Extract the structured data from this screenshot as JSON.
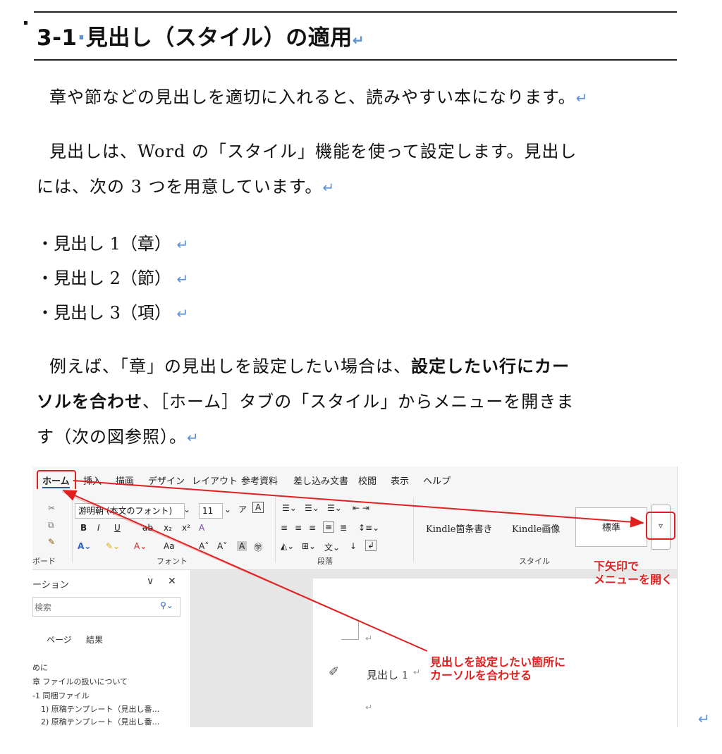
{
  "heading": {
    "number": "3-1",
    "dot": "·",
    "title": "見出し（スタイル）の適用",
    "return_mark": "↵"
  },
  "paragraphs": {
    "p1": "章や節などの見出しを適切に入れると、読みやすい本になります。",
    "p2a": "見出しは、Word の「スタイル」機能を使って設定します。見出し",
    "p2b": "には、次の 3 つを用意しています。",
    "p3_pre": "例えば、「章」の見出しを設定したい場合は、",
    "p3_bold1": "設定したい行にカー",
    "p3_bold2": "ソルを合わせ",
    "p3_mid": "、［ホーム］タブの「スタイル」からメニューを開きま",
    "p3_end": "す（次の図参照）。"
  },
  "list": [
    "・見出し 1（章）",
    "・見出し 2（節）",
    "・見出し 3（項）"
  ],
  "return_mark": "↵",
  "screenshot": {
    "tabs": [
      "ホーム",
      "挿入",
      "描画",
      "デザイン",
      "レイアウト",
      "参考資料",
      "差し込み文書",
      "校閲",
      "表示",
      "ヘルプ"
    ],
    "font_name": "游明朝 (本文のフォント)",
    "font_size": "11",
    "font_group": "フォント",
    "paragraph_group": "段落",
    "style_group": "スタイル",
    "clipboard_group": "ボード",
    "styles": [
      "Kindle箇条書き",
      "Kindle画像",
      "標準"
    ],
    "nav_title": "ーション",
    "nav_search": "検索",
    "nav_tabs": [
      "ページ",
      "結果"
    ],
    "nav_items": [
      "めに",
      "章 ファイルの扱いについて",
      "-1 同梱ファイル",
      "1) 原稿テンプレート（見出し番…",
      "2) 原稿テンプレート（見出し番…"
    ],
    "doc_text": "見出し 1",
    "callouts": {
      "dropdown": [
        "下矢印で",
        "メニューを開く"
      ],
      "cursor": [
        "見出しを設定したい箇所に",
        "カーソルを合わせる"
      ]
    },
    "accent_color": "#e02020"
  }
}
